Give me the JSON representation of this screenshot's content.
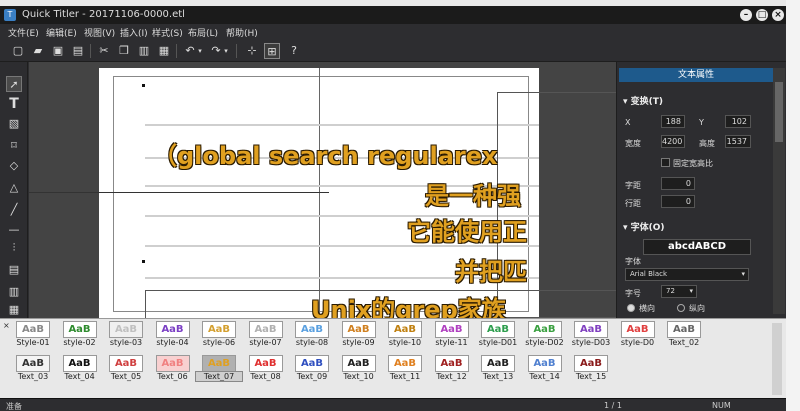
{
  "window": {
    "title": "Quick Titler - 20171106-0000.etl",
    "app_icon": "T"
  },
  "menu": [
    "文件(E)",
    "编辑(E)",
    "视图(V)",
    "插入(I)",
    "样式(S)",
    "布局(L)",
    "帮助(H)"
  ],
  "canvas": {
    "line1": "（global search regularex",
    "line2": "是一种强",
    "line3": "它能使用正",
    "line4": "并把匹",
    "line5": "Unix的grep家族"
  },
  "panel": {
    "header": "文本属性",
    "transform_title": "变换(T)",
    "x_label": "X",
    "x_value": "188",
    "y_label": "Y",
    "y_value": "102",
    "width_label": "宽度",
    "width_value": "4200",
    "height_label": "高度",
    "height_value": "1537",
    "lock_aspect": "固定宽高比",
    "char_spacing_label": "字距",
    "char_spacing_value": "0",
    "line_spacing_label": "行距",
    "line_spacing_value": "0",
    "font_title": "字体(O)",
    "font_preview": "abcdABCD",
    "font_label": "字体",
    "font_value": "Arial Black",
    "size_label": "字号",
    "size_value": "72",
    "horizontal": "横向",
    "vertical": "纵向"
  },
  "styles": {
    "row1": [
      {
        "name": "Style-01",
        "color": "#888888",
        "bg": "#ffffff"
      },
      {
        "name": "style-02",
        "color": "#2e8b2e",
        "bg": "#ffffff"
      },
      {
        "name": "style-03",
        "color": "#c0c0c0",
        "bg": "#f0f0f0"
      },
      {
        "name": "style-04",
        "color": "#7b3fc4",
        "bg": "#ffffff"
      },
      {
        "name": "style-06",
        "color": "#d4a030",
        "bg": "#ffffff"
      },
      {
        "name": "style-07",
        "color": "#b0b0b0",
        "bg": "#ffffff"
      },
      {
        "name": "style-08",
        "color": "#5aa0e0",
        "bg": "#ffffff"
      },
      {
        "name": "style-09",
        "color": "#d08020",
        "bg": "#ffffff"
      },
      {
        "name": "style-10",
        "color": "#c08010",
        "bg": "#ffffff"
      },
      {
        "name": "style-11",
        "color": "#b040c0",
        "bg": "#ffffff"
      },
      {
        "name": "style-D01",
        "color": "#2e9e4e",
        "bg": "#ffffff"
      },
      {
        "name": "style-D02",
        "color": "#3aa040",
        "bg": "#ffffff"
      },
      {
        "name": "style-D03",
        "color": "#8040c0",
        "bg": "#ffffff"
      },
      {
        "name": "style-D0",
        "color": "#e04040",
        "bg": "#ffffff"
      },
      {
        "name": "Text_02",
        "color": "#666666",
        "bg": "#ffffff"
      }
    ],
    "row2": [
      {
        "name": "Text_03",
        "color": "#333333",
        "bg": "#f4f4f4"
      },
      {
        "name": "Text_04",
        "color": "#111111",
        "bg": "#ffffff"
      },
      {
        "name": "Text_05",
        "color": "#d04040",
        "bg": "#ffffff"
      },
      {
        "name": "Text_06",
        "color": "#f08080",
        "bg": "#f8d0d0"
      },
      {
        "name": "Text_07",
        "color": "#e0a020",
        "bg": "#b0b0b0"
      },
      {
        "name": "Text_08",
        "color": "#e03030",
        "bg": "#ffffff"
      },
      {
        "name": "Text_09",
        "color": "#3050c0",
        "bg": "#ffffff"
      },
      {
        "name": "Text_10",
        "color": "#222222",
        "bg": "#ffffff"
      },
      {
        "name": "Text_11",
        "color": "#e08020",
        "bg": "#ffffff"
      },
      {
        "name": "Text_12",
        "color": "#a02020",
        "bg": "#ffffff"
      },
      {
        "name": "Text_13",
        "color": "#222222",
        "bg": "#ffffff"
      },
      {
        "name": "Text_14",
        "color": "#5080d0",
        "bg": "#ffffff"
      },
      {
        "name": "Text_15",
        "color": "#8a1a1a",
        "bg": "#ffffff"
      }
    ],
    "selected": "Text_07"
  },
  "status": {
    "left": "准备",
    "page": "1 / 1",
    "mode": "NUM"
  }
}
